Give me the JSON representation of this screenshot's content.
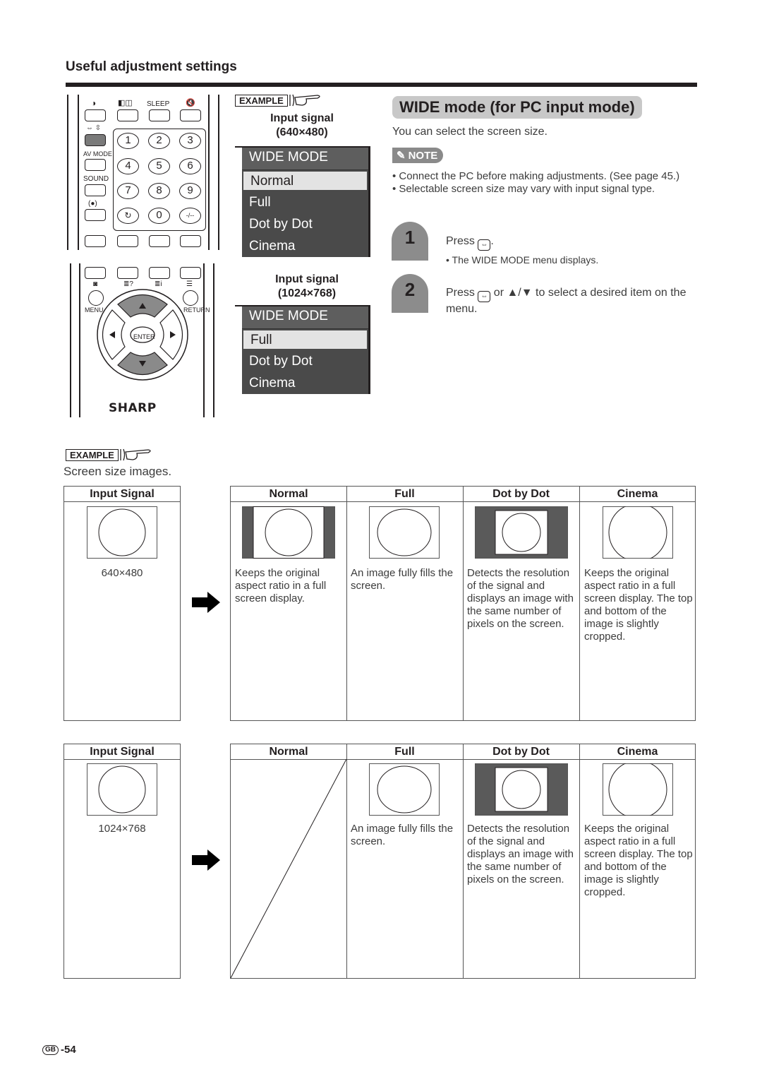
{
  "section_title": "Useful adjustment settings",
  "remote": {
    "top_labels": [
      "◑",
      "◧◫",
      "SLEEP",
      "🔇"
    ],
    "wide_icons": "⇔ ⇳",
    "side_labels": [
      "AV MODE",
      "SOUND",
      "(●)"
    ],
    "numbers": [
      "1",
      "2",
      "3",
      "4",
      "5",
      "6",
      "7",
      "8",
      "9",
      "↻",
      "0",
      "-/--"
    ],
    "menu_label": "MENU",
    "return_label": "RETURN",
    "enter_label": "ENTER",
    "brand": "SHARP"
  },
  "example_label": "EXAMPLE",
  "menus": [
    {
      "signal_label": "Input signal",
      "signal_res": "(640×480)",
      "title": "WIDE MODE",
      "items": [
        "Normal",
        "Full",
        "Dot by Dot",
        "Cinema"
      ],
      "selected": "Normal"
    },
    {
      "signal_label": "Input signal",
      "signal_res": "(1024×768)",
      "title": "WIDE MODE",
      "items": [
        "Full",
        "Dot by Dot",
        "Cinema"
      ],
      "selected": "Full"
    }
  ],
  "main": {
    "title": "WIDE mode (for PC input mode)",
    "subtitle": "You can select the screen size.",
    "note_label": "NOTE",
    "notes": [
      "• Connect the PC before making adjustments. (See page 45.)",
      "• Selectable screen size may vary with input signal type."
    ],
    "steps": [
      {
        "number": "1",
        "text_before": "Press ",
        "text_after": ".",
        "sub": "• The WIDE MODE menu displays."
      },
      {
        "number": "2",
        "text_before": "Press ",
        "text_after": " or ▲/▼ to select a desired item on the menu.",
        "sub": ""
      }
    ]
  },
  "screen_caption": "Screen size images.",
  "tables": [
    {
      "input_header": "Input Signal",
      "resolution": "640×480",
      "headers": [
        "Normal",
        "Full",
        "Dot by Dot",
        "Cinema"
      ],
      "descriptions": [
        "Keeps the original aspect ratio in a full screen display.",
        "An image fully fills the screen.",
        "Detects the resolution of the signal and displays an image with the same number of pixels on the screen.",
        "Keeps the original aspect ratio in a full screen display. The top and bottom of the image is slightly cropped."
      ]
    },
    {
      "input_header": "Input Signal",
      "resolution": "1024×768",
      "headers": [
        "Normal",
        "Full",
        "Dot by Dot",
        "Cinema"
      ],
      "descriptions": [
        "",
        "An image fully fills the screen.",
        "Detects the resolution of the signal and displays an image with the same number of pixels on the screen.",
        "Keeps the original aspect ratio in a full screen display. The top and bottom of the image is slightly cropped."
      ]
    }
  ],
  "page": {
    "region": "GB",
    "number": "-54"
  }
}
